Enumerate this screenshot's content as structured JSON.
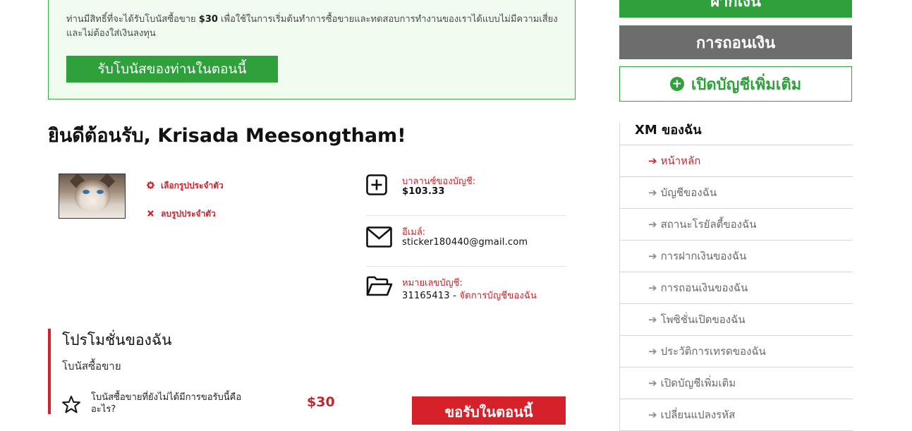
{
  "bonus": {
    "text_before": "ท่านมีสิทธิ์ที่จะได้รับโบนัสซื้อขาย ",
    "amount": "$30",
    "text_after": " เพื่อใช้ในการเริ่มต้นทำการซื้อขายและทดสอบการทำงานของเราได้แบบไม่มีความเสี่ยงและไม่ต้องใส่เงินลงทุน",
    "button_label": "รับโบนัสของท่านในตอนนี้"
  },
  "welcome": {
    "title": "ยินดีต้อนรับ, Krisada Meesongtham!"
  },
  "profile_picture": {
    "select_label": "เลือกรูปประจำตัว",
    "remove_label": "ลบรูปประจำตัว"
  },
  "account": {
    "balance_label": "บาลานซ์ของบัญชี:",
    "balance_value": "$103.33",
    "email_label": "อีเมล์:",
    "email_value": "sticker180440@gmail.com",
    "number_label": "หมายเลขบัญชี:",
    "number_value": "31165413 - ",
    "manage_link": "จัดการบัญชีของฉัน"
  },
  "promotions": {
    "title": "โปรโมชั่นของฉัน",
    "subtitle": "โบนัสซื้อขาย",
    "question": "โบนัสซื้อขายที่ยังไม่ได้มีการขอรับนี้คืออะไร?",
    "amount": "$30",
    "claim_button": "ขอรับในตอนนี้"
  },
  "sidebar": {
    "deposit_label": "ฝากเงิน",
    "withdraw_label": "การถอนเงิน",
    "open_account_label": "เปิดบัญชีเพิ่มเติม",
    "nav_title": "XM ของฉัน",
    "items": [
      {
        "label": "หน้าหลัก"
      },
      {
        "label": "บัญชีของฉัน"
      },
      {
        "label": "สถานะโรยัลตี้ของฉัน"
      },
      {
        "label": "การฝากเงินของฉัน"
      },
      {
        "label": "การถอนเงินของฉัน"
      },
      {
        "label": "โพซิชั่นเปิดของฉัน"
      },
      {
        "label": "ประวัติการเทรดของฉัน"
      },
      {
        "label": "เปิดบัญชีเพิ่มเติม"
      },
      {
        "label": "เปลี่ยนแปลงรหัส"
      }
    ]
  },
  "colors": {
    "brand_green": "#2ea13a",
    "brand_red": "#d6212b",
    "neutral_gray": "#6d6d6d"
  },
  "icons": {
    "gear": "gear-icon",
    "remove": "close-icon",
    "balance": "plus-square-icon",
    "email": "envelope-icon",
    "account_number": "folder-open-icon",
    "promo": "star-icon",
    "nav_arrow": "arrow-right-icon",
    "open_account": "plus-circle-icon"
  }
}
